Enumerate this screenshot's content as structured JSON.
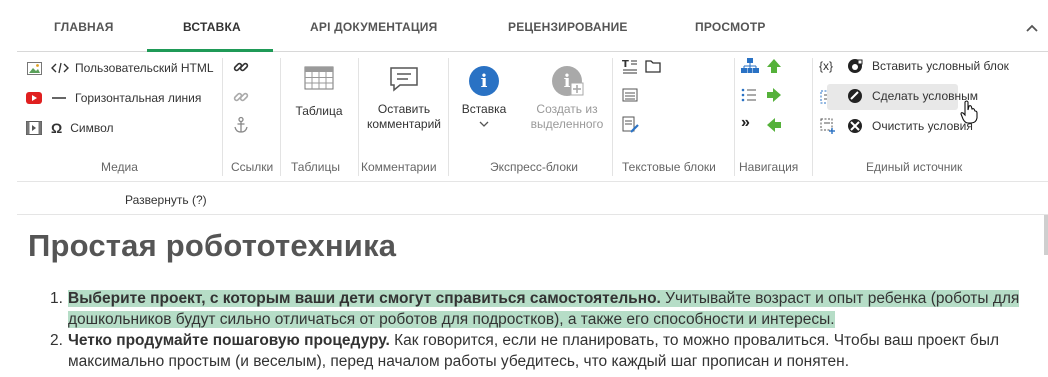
{
  "tabs": [
    "ГЛАВНАЯ",
    "ВСТАВКА",
    "API ДОКУМЕНТАЦИЯ",
    "РЕЦЕНЗИРОВАНИЕ",
    "ПРОСМОТР"
  ],
  "active_tab": "ВСТАВКА",
  "ribbon": {
    "media": {
      "label": "Медиа",
      "items": [
        "Пользовательский HTML",
        "Горизонтальная линия",
        "Символ"
      ]
    },
    "links": {
      "label": "Ссылки"
    },
    "tables": {
      "label": "Таблицы",
      "button": "Таблица"
    },
    "comments": {
      "label": "Комментарии",
      "button_line1": "Оставить",
      "button_line2": "комментарий"
    },
    "express": {
      "label": "Экспресс-блоки",
      "insert": "Вставка",
      "create_line1": "Создать из",
      "create_line2": "выделенного"
    },
    "text_blocks": {
      "label": "Текстовые блоки"
    },
    "navigation": {
      "label": "Навигация"
    },
    "single_source": {
      "label": "Единый источник",
      "var_symbol": "{x}",
      "items": [
        "Вставить условный блок",
        "Сделать условным",
        "Очистить условия"
      ]
    }
  },
  "expand_link": "Развернуть (?)",
  "document": {
    "title": "Простая робототехника",
    "items": [
      {
        "num": "1.",
        "bold": "Выберите проект, с которым ваши дети смогут справиться самостоятельно.",
        "text": " Учитывайте возраст и опыт ребенка (роботы для дошкольников будут сильно отличаться от роботов для подростков), а также его способности и интересы."
      },
      {
        "num": "2.",
        "bold": "Четко продумайте пошаговую процедуру.",
        "text": " Как говорится, если не планировать, то можно провалиться. Чтобы ваш проект был максимально простым (и веселым), перед началом работы убедитесь, что каждый шаг прописан и понятен."
      }
    ]
  },
  "colors": {
    "accent": "#1f9a57",
    "highlight": "#b6ddc7",
    "info_blue": "#2a72c4",
    "disabled_gray": "#a9a9a9",
    "nav_green": "#55b13a",
    "youtube_red": "#e02020"
  }
}
